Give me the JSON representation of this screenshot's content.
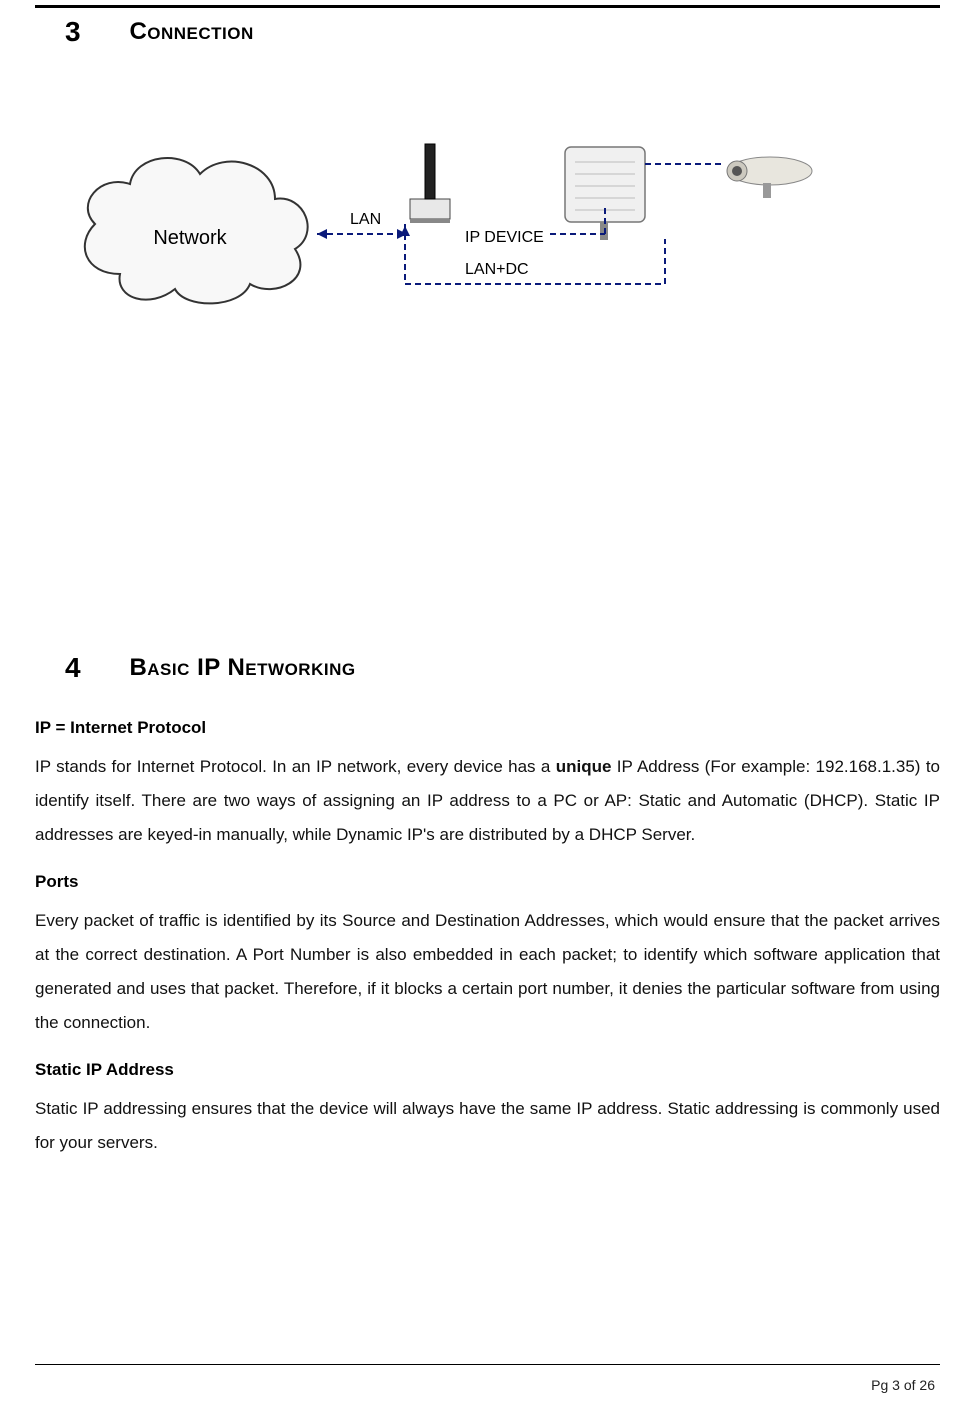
{
  "section3": {
    "number": "3",
    "title": "Connection"
  },
  "diagram": {
    "cloud_label": "Network",
    "lan_label": "LAN",
    "ip_device_label": "IP DEVICE",
    "landc_label": "LAN+DC"
  },
  "section4": {
    "number": "4",
    "title": "Basic IP Networking"
  },
  "ip_protocol": {
    "heading": "IP = Internet Protocol",
    "part1": "IP stands for Internet Protocol. In an IP network, every device has a ",
    "bold": "unique",
    "part2": " IP Address (For example: 192.168.1.35) to identify itself. There are two ways of assigning an IP address to a PC or AP: Static and Automatic (DHCP). Static IP addresses are keyed-in manually, while Dynamic IP's are distributed by a DHCP Server."
  },
  "ports": {
    "heading": "Ports",
    "body": "Every packet of traffic is identified by its Source and Destination Addresses, which would ensure that the packet arrives at the correct destination. A Port Number is also embedded in each packet; to identify which software application that generated and uses that packet. Therefore, if it blocks a certain port number, it denies the particular software from using the connection."
  },
  "static_ip": {
    "heading": "Static IP Address",
    "body": "Static IP addressing ensures that the device will always have the same IP address. Static addressing is commonly used for your servers."
  },
  "footer": "Pg 3 of 26"
}
